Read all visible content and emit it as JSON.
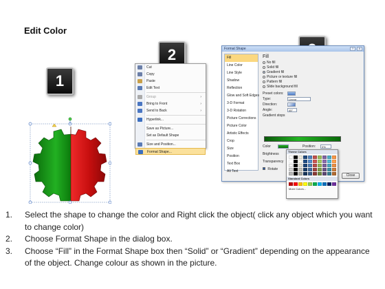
{
  "title": "Edit Color",
  "badges": [
    "1",
    "2",
    "3"
  ],
  "context_menu": {
    "items": [
      {
        "label": "Cut",
        "icon": "scissors-icon",
        "color": "#6b7fa8"
      },
      {
        "label": "Copy",
        "icon": "copy-icon",
        "color": "#6b7fa8"
      },
      {
        "label": "Paste",
        "icon": "paste-icon",
        "color": "#c9a04a"
      },
      {
        "label": "Edit Text",
        "icon": "edit-text-icon",
        "color": "#5a7bb5"
      },
      {
        "label": "Group",
        "icon": "group-icon",
        "color": "#aaaaaa",
        "disabled": true,
        "submenu": true
      },
      {
        "label": "Bring to Front",
        "icon": "bring-front-icon",
        "color": "#4a76c2",
        "submenu": true
      },
      {
        "label": "Send to Back",
        "icon": "send-back-icon",
        "color": "#4a76c2",
        "submenu": true
      },
      {
        "label": "Hyperlink...",
        "icon": "hyperlink-icon",
        "color": "#3b6fc0"
      },
      {
        "label": "Save as Picture...",
        "icon": "",
        "color": ""
      },
      {
        "label": "Set as Default Shape",
        "icon": "",
        "color": ""
      },
      {
        "label": "Size and Position...",
        "icon": "size-position-icon",
        "color": "#5a7bb5"
      },
      {
        "label": "Format Shape...",
        "icon": "format-shape-icon",
        "color": "#3b6fc0",
        "highlighted": true
      }
    ]
  },
  "format_dialog": {
    "title": "Format Shape",
    "help_label": "?",
    "close_label": "X",
    "nav": [
      "Fill",
      "Line Color",
      "Line Style",
      "Shadow",
      "Reflection",
      "Glow and Soft Edges",
      "3-D Format",
      "3-D Rotation",
      "Picture Corrections",
      "Picture Color",
      "Artistic Effects",
      "Crop",
      "Size",
      "Position",
      "Text Box",
      "Alt Text"
    ],
    "nav_selected": "Fill",
    "section_heading": "Fill",
    "fill_options": [
      {
        "label": "No fill",
        "selected": false
      },
      {
        "label": "Solid fill",
        "selected": false
      },
      {
        "label": "Gradient fill",
        "selected": true
      },
      {
        "label": "Picture or texture fill",
        "selected": false
      },
      {
        "label": "Pattern fill",
        "selected": false
      },
      {
        "label": "Slide background fill",
        "selected": false
      }
    ],
    "preset_colors_label": "Preset colors:",
    "type_label": "Type:",
    "type_value": "Linear",
    "direction_label": "Direction:",
    "angle_label": "Angle:",
    "angle_value": "45°",
    "gradient_stops_label": "Gradient stops",
    "color_label": "Color",
    "position_label": "Position:",
    "position_value": "0%",
    "brightness_label": "Brightness",
    "transparency_label": "Transparency",
    "rotate_label": "Rotate",
    "theme_colors_label": "Theme Colors",
    "standard_colors_label": "Standard Colors",
    "more_colors_label": "More Colors...",
    "close_button": "Close"
  },
  "colors": {
    "gear_green": "#1e9e1e",
    "gear_red": "#d11414",
    "menu_highlight": "#fbe19c",
    "gradient_green": "#23b523"
  },
  "steps": [
    {
      "num": "1.",
      "text": "Select the shape to change the color and Right click the object( click any object which you want to change color)"
    },
    {
      "num": "2.",
      "text": "Choose Format Shape in the dialog box."
    },
    {
      "num": "3.",
      "text": "Choose “Fill” in the Format Shape box then “Solid” or “Gradient” depending on the appearance of the object. Change colour as shown in the picture."
    }
  ]
}
